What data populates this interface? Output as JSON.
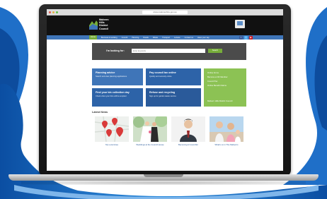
{
  "browser": {
    "url": "www.maloneshire.gov.au"
  },
  "site": {
    "logo_text": "Malvern\nHills\nDistrict\nCouncil"
  },
  "nav": {
    "items": [
      "Home",
      "Business & working",
      "Council",
      "Planning",
      "Roads",
      "Waste",
      "Transport",
      "Leisure",
      "Contact us",
      "Have your say"
    ],
    "social": [
      {
        "name": "facebook-icon",
        "glyph": "f",
        "color": "#3b5998"
      },
      {
        "name": "twitter-icon",
        "glyph": "t",
        "color": "#55acee"
      },
      {
        "name": "youtube-icon",
        "glyph": "▶",
        "color": "#cc181e"
      }
    ]
  },
  "search": {
    "label": "I'm looking for:",
    "placeholder": "Enter keywords",
    "button": "Search"
  },
  "tiles": [
    {
      "title": "Planning advice",
      "sub": "Search and view planning applications",
      "color": "#3f75b8"
    },
    {
      "title": "Pay council tax online",
      "sub": "Quickly and securely online",
      "color": "#2d63a8"
    },
    {
      "title": "Find your bin collection day",
      "sub": "Check when your bins will be emptied",
      "color": "#2d63a8"
    },
    {
      "title": "Refuse and recycling",
      "sub": "Sign up for garden waste service",
      "color": "#2a5a9a"
    }
  ],
  "green_tile": {
    "lines": [
      "Online forms",
      "Become a Cllr Member",
      "Council Tax",
      "Online Benefit Claims"
    ],
    "bottom": "Malvern Hills District Council"
  },
  "news": {
    "heading": "Latest News",
    "items": [
      {
        "caption": "My Local Area"
      },
      {
        "caption": "Weddings at the Council House"
      },
      {
        "caption": "Becoming A Councillor"
      },
      {
        "caption": "What's on in The Malverns"
      }
    ]
  },
  "colors": {
    "nav_blue": "#3f75b8",
    "accent_green": "#8cc254",
    "header_black": "#111111"
  }
}
